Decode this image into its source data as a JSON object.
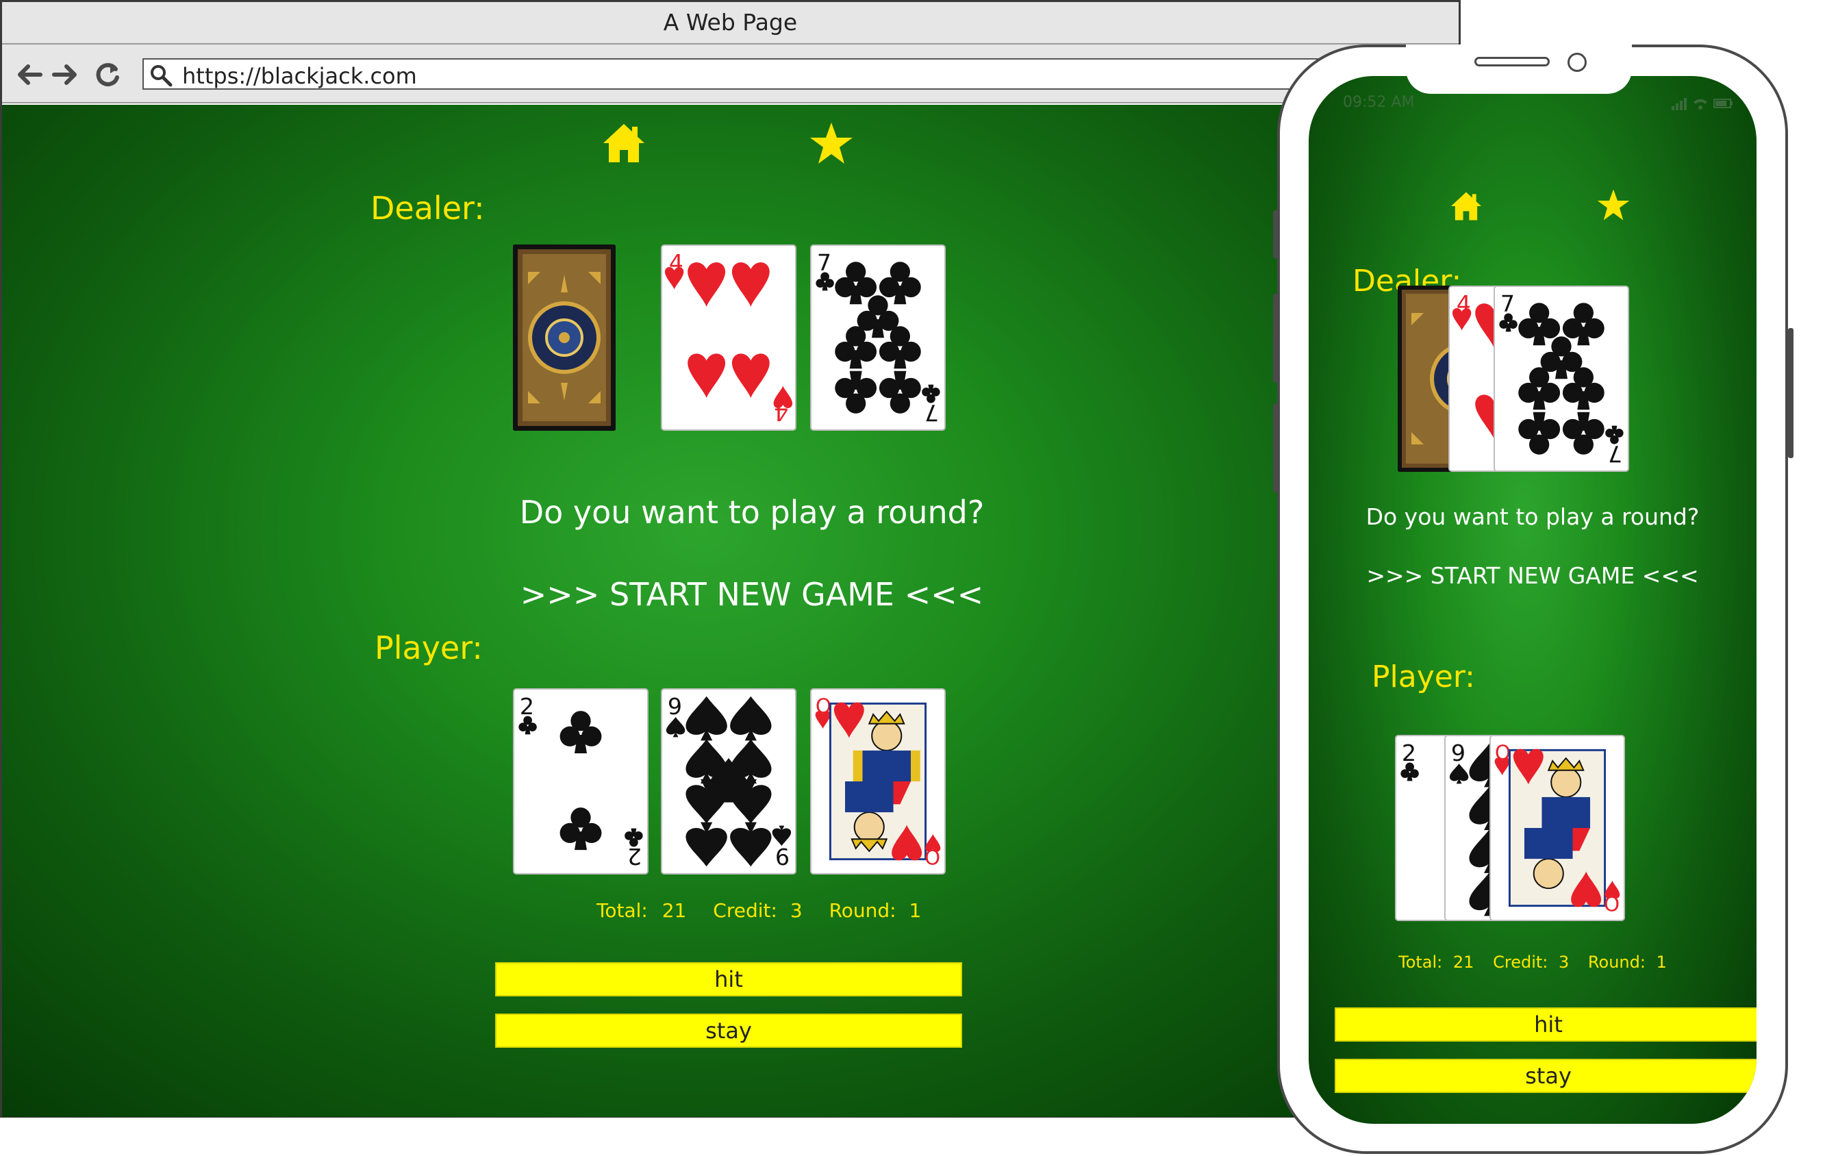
{
  "browser": {
    "window_title": "A Web Page",
    "url": "https://blackjack.com"
  },
  "nav": {
    "home_icon": "home-icon",
    "favorite_icon": "star-icon"
  },
  "game": {
    "dealer_label": "Dealer:",
    "player_label": "Player:",
    "prompt": "Do you want to play a round?",
    "start_label": ">>> START NEW GAME <<<",
    "dealer_cards": [
      {
        "face": "back"
      },
      {
        "rank": "4",
        "suit": "hearts"
      },
      {
        "rank": "7",
        "suit": "clubs"
      }
    ],
    "player_cards": [
      {
        "rank": "2",
        "suit": "clubs"
      },
      {
        "rank": "9",
        "suit": "spades"
      },
      {
        "rank": "Q",
        "suit": "hearts"
      }
    ],
    "stats": {
      "total_label": "Total:",
      "total_value": "21",
      "credit_label": "Credit:",
      "credit_value": "3",
      "round_label": "Round:",
      "round_value": "1"
    },
    "hit_label": "hit",
    "stay_label": "stay"
  },
  "phone": {
    "status_time": "09:52 AM"
  },
  "colors": {
    "accent_yellow": "#ffe600",
    "button_yellow": "#ffff00",
    "felt_center": "#2da52d",
    "felt_edge": "#053805",
    "heart_red": "#e8202a"
  }
}
